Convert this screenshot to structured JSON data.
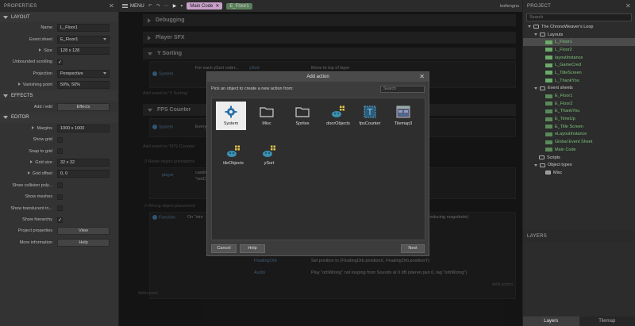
{
  "properties": {
    "title": "PROPERTIES",
    "sections": [
      {
        "title": "LAYOUT",
        "rows": [
          {
            "label": "Name",
            "type": "text",
            "value": "L_Floor1"
          },
          {
            "label": "Event sheet",
            "type": "select",
            "value": "E_Floor1"
          },
          {
            "label": "Size",
            "type": "text",
            "value": "128 x 128",
            "expandable": true
          },
          {
            "label": "Unbounded scrolling",
            "type": "check",
            "checked": true
          },
          {
            "label": "Projection",
            "type": "select",
            "value": "Perspective"
          },
          {
            "label": "Vanishing point",
            "type": "text",
            "value": "50%, 50%",
            "expandable": true
          }
        ]
      },
      {
        "title": "EFFECTS",
        "rows": [
          {
            "label": "Add / edit",
            "type": "button",
            "value": "Effects"
          }
        ]
      },
      {
        "title": "EDITOR",
        "rows": [
          {
            "label": "Margins",
            "type": "text",
            "value": "1000 x 1000",
            "expandable": true
          },
          {
            "label": "Show grid",
            "type": "check",
            "checked": false
          },
          {
            "label": "Snap to grid",
            "type": "check",
            "checked": false
          },
          {
            "label": "Grid size",
            "type": "text",
            "value": "32 x 32",
            "expandable": true
          },
          {
            "label": "Grid offset",
            "type": "text",
            "value": "0, 0",
            "expandable": true
          },
          {
            "label": "Show collision poly...",
            "type": "check",
            "checked": false
          },
          {
            "label": "Show meshes",
            "type": "check",
            "checked": false
          },
          {
            "label": "Show translucent in...",
            "type": "check",
            "checked": false
          },
          {
            "label": "Show hierarchy",
            "type": "check",
            "checked": true
          },
          {
            "label": "Project properties",
            "type": "button",
            "value": "View"
          },
          {
            "label": "More information",
            "type": "button",
            "value": "Help"
          }
        ]
      }
    ]
  },
  "topbar": {
    "menu": "MENU",
    "tabs": [
      "Main Code",
      "E_Floor1"
    ],
    "user": "bollengnu"
  },
  "sheet": {
    "groups": [
      "Debugging",
      "Player SFX",
      "Y Sorting",
      "FPS Counter"
    ],
    "ysort": {
      "sys": "System",
      "cond": "For each ySort order... ",
      "obj": "ySort",
      "action": "Move to top of layer"
    },
    "fps": {
      "sys": "System",
      "cond": "Every..."
    },
    "add_event": "Add event to 'Y Sorting'",
    "add_event_fps": "Add event to 'FPS Counter'",
    "add_action": "Add action",
    "comment1": "// Reset object animations",
    "comment2": "// Wrong object placement",
    "player": "player",
    "casting": "casting",
    "notcast": "\"notCas",
    "fn": "Function",
    "on_wrong": "On \"wro",
    "magnitude": "reducing magnitude)",
    "floating": "FloatingOrb",
    "set_pos": "Set position to (FloatingOrb.positionX, FloatingOrb.positionY)",
    "audio": "Audio",
    "play": "Play \"orbWrong\" not looping from Sounds at 0 dB (stereo pan 0, tag \"orbWrong\")",
    "add_action2": "Add action",
    "add_event2": "Add event"
  },
  "dialog": {
    "title": "Add action",
    "prompt": "Pick an object to create a new action from:",
    "search_placeholder": "Search",
    "objects": [
      {
        "label": "System",
        "icon": "gear-icon",
        "selected": true
      },
      {
        "label": "Misc",
        "icon": "folder-icon"
      },
      {
        "label": "Sprites",
        "icon": "folder-icon"
      },
      {
        "label": "doorObjects",
        "icon": "family-icon"
      },
      {
        "label": "fpsCounter",
        "icon": "text-object-icon"
      },
      {
        "label": "Tilemap3",
        "icon": "tilemap-icon"
      },
      {
        "label": "tileObjects",
        "icon": "family-icon"
      },
      {
        "label": "ySort",
        "icon": "family-icon"
      }
    ],
    "cancel": "Cancel",
    "help": "Help",
    "next": "Next"
  },
  "project": {
    "title": "PROJECT",
    "search_placeholder": "Search",
    "root": "The ChronoWeaver's Loop",
    "layouts_folder": "Layouts",
    "layouts": [
      "L_Floor1",
      "L_Floor2",
      "layoutInstance",
      "L_GameCred",
      "L_TitleScreen",
      "L_ThankYou"
    ],
    "eventsheets_folder": "Event sheets",
    "eventsheets": [
      "E_Floor1",
      "E_Floor2",
      "E_ThankYou",
      "E_TimeUp",
      "E_Title Screen",
      "eLayoutInstance",
      "Global Event Sheet",
      "Main Code"
    ],
    "scripts_folder": "Scripts",
    "objecttypes_folder": "Object types",
    "misc_folder": "Misc"
  },
  "layers": {
    "title": "LAYERS",
    "tabs": [
      "Layers",
      "Tilemap"
    ]
  },
  "colors": {
    "accent_green": "#7bc27b",
    "tab_main": "#c9a0c9",
    "selection": "#ededed"
  }
}
